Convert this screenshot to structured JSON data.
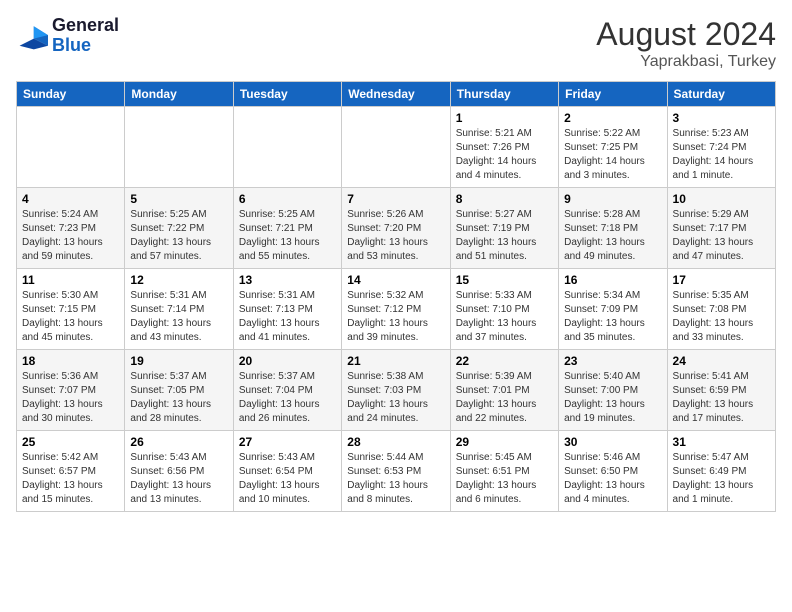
{
  "header": {
    "logo_general": "General",
    "logo_blue": "Blue",
    "month_year": "August 2024",
    "location": "Yaprakbasi, Turkey"
  },
  "calendar": {
    "days_of_week": [
      "Sunday",
      "Monday",
      "Tuesday",
      "Wednesday",
      "Thursday",
      "Friday",
      "Saturday"
    ],
    "weeks": [
      [
        {
          "day": "",
          "info": ""
        },
        {
          "day": "",
          "info": ""
        },
        {
          "day": "",
          "info": ""
        },
        {
          "day": "",
          "info": ""
        },
        {
          "day": "1",
          "info": "Sunrise: 5:21 AM\nSunset: 7:26 PM\nDaylight: 14 hours\nand 4 minutes."
        },
        {
          "day": "2",
          "info": "Sunrise: 5:22 AM\nSunset: 7:25 PM\nDaylight: 14 hours\nand 3 minutes."
        },
        {
          "day": "3",
          "info": "Sunrise: 5:23 AM\nSunset: 7:24 PM\nDaylight: 14 hours\nand 1 minute."
        }
      ],
      [
        {
          "day": "4",
          "info": "Sunrise: 5:24 AM\nSunset: 7:23 PM\nDaylight: 13 hours\nand 59 minutes."
        },
        {
          "day": "5",
          "info": "Sunrise: 5:25 AM\nSunset: 7:22 PM\nDaylight: 13 hours\nand 57 minutes."
        },
        {
          "day": "6",
          "info": "Sunrise: 5:25 AM\nSunset: 7:21 PM\nDaylight: 13 hours\nand 55 minutes."
        },
        {
          "day": "7",
          "info": "Sunrise: 5:26 AM\nSunset: 7:20 PM\nDaylight: 13 hours\nand 53 minutes."
        },
        {
          "day": "8",
          "info": "Sunrise: 5:27 AM\nSunset: 7:19 PM\nDaylight: 13 hours\nand 51 minutes."
        },
        {
          "day": "9",
          "info": "Sunrise: 5:28 AM\nSunset: 7:18 PM\nDaylight: 13 hours\nand 49 minutes."
        },
        {
          "day": "10",
          "info": "Sunrise: 5:29 AM\nSunset: 7:17 PM\nDaylight: 13 hours\nand 47 minutes."
        }
      ],
      [
        {
          "day": "11",
          "info": "Sunrise: 5:30 AM\nSunset: 7:15 PM\nDaylight: 13 hours\nand 45 minutes."
        },
        {
          "day": "12",
          "info": "Sunrise: 5:31 AM\nSunset: 7:14 PM\nDaylight: 13 hours\nand 43 minutes."
        },
        {
          "day": "13",
          "info": "Sunrise: 5:31 AM\nSunset: 7:13 PM\nDaylight: 13 hours\nand 41 minutes."
        },
        {
          "day": "14",
          "info": "Sunrise: 5:32 AM\nSunset: 7:12 PM\nDaylight: 13 hours\nand 39 minutes."
        },
        {
          "day": "15",
          "info": "Sunrise: 5:33 AM\nSunset: 7:10 PM\nDaylight: 13 hours\nand 37 minutes."
        },
        {
          "day": "16",
          "info": "Sunrise: 5:34 AM\nSunset: 7:09 PM\nDaylight: 13 hours\nand 35 minutes."
        },
        {
          "day": "17",
          "info": "Sunrise: 5:35 AM\nSunset: 7:08 PM\nDaylight: 13 hours\nand 33 minutes."
        }
      ],
      [
        {
          "day": "18",
          "info": "Sunrise: 5:36 AM\nSunset: 7:07 PM\nDaylight: 13 hours\nand 30 minutes."
        },
        {
          "day": "19",
          "info": "Sunrise: 5:37 AM\nSunset: 7:05 PM\nDaylight: 13 hours\nand 28 minutes."
        },
        {
          "day": "20",
          "info": "Sunrise: 5:37 AM\nSunset: 7:04 PM\nDaylight: 13 hours\nand 26 minutes."
        },
        {
          "day": "21",
          "info": "Sunrise: 5:38 AM\nSunset: 7:03 PM\nDaylight: 13 hours\nand 24 minutes."
        },
        {
          "day": "22",
          "info": "Sunrise: 5:39 AM\nSunset: 7:01 PM\nDaylight: 13 hours\nand 22 minutes."
        },
        {
          "day": "23",
          "info": "Sunrise: 5:40 AM\nSunset: 7:00 PM\nDaylight: 13 hours\nand 19 minutes."
        },
        {
          "day": "24",
          "info": "Sunrise: 5:41 AM\nSunset: 6:59 PM\nDaylight: 13 hours\nand 17 minutes."
        }
      ],
      [
        {
          "day": "25",
          "info": "Sunrise: 5:42 AM\nSunset: 6:57 PM\nDaylight: 13 hours\nand 15 minutes."
        },
        {
          "day": "26",
          "info": "Sunrise: 5:43 AM\nSunset: 6:56 PM\nDaylight: 13 hours\nand 13 minutes."
        },
        {
          "day": "27",
          "info": "Sunrise: 5:43 AM\nSunset: 6:54 PM\nDaylight: 13 hours\nand 10 minutes."
        },
        {
          "day": "28",
          "info": "Sunrise: 5:44 AM\nSunset: 6:53 PM\nDaylight: 13 hours\nand 8 minutes."
        },
        {
          "day": "29",
          "info": "Sunrise: 5:45 AM\nSunset: 6:51 PM\nDaylight: 13 hours\nand 6 minutes."
        },
        {
          "day": "30",
          "info": "Sunrise: 5:46 AM\nSunset: 6:50 PM\nDaylight: 13 hours\nand 4 minutes."
        },
        {
          "day": "31",
          "info": "Sunrise: 5:47 AM\nSunset: 6:49 PM\nDaylight: 13 hours\nand 1 minute."
        }
      ]
    ]
  }
}
